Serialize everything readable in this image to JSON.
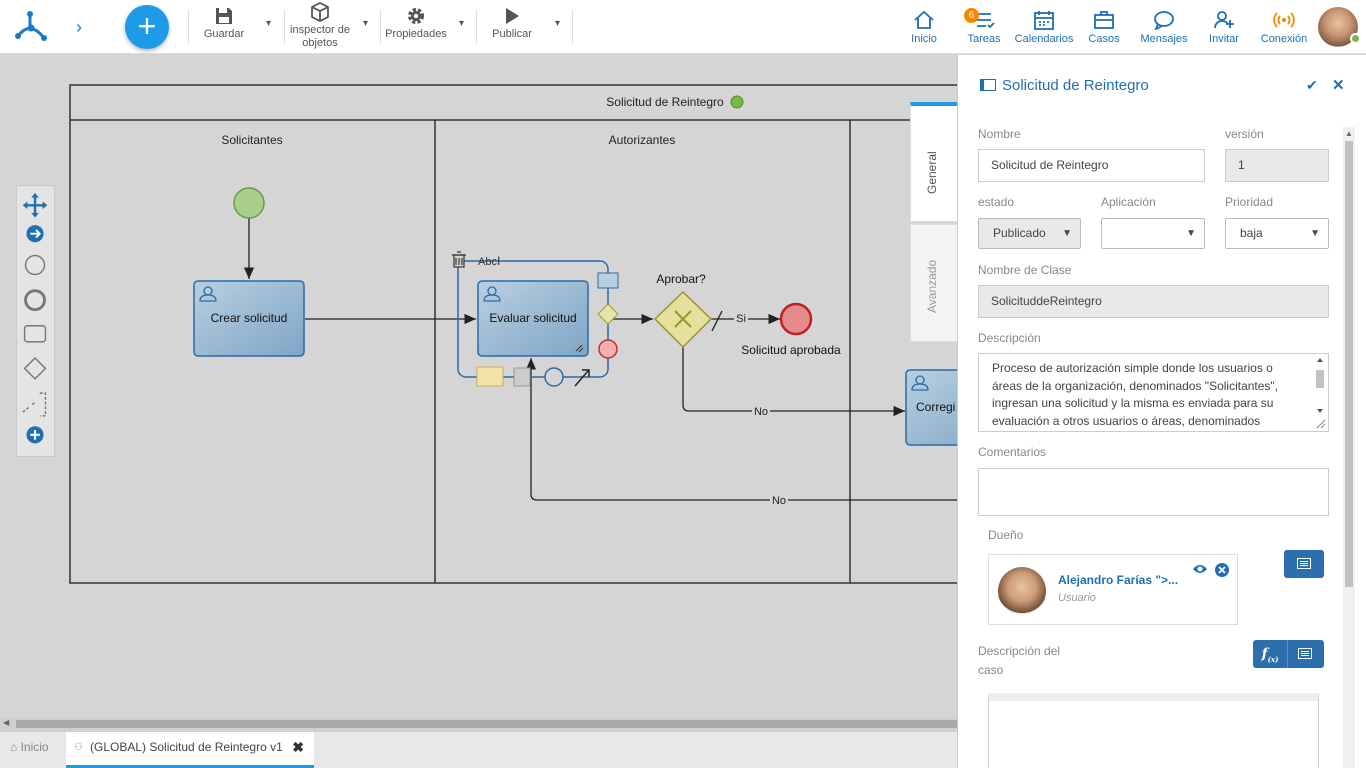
{
  "toolbar": {
    "save_label": "Guardar",
    "inspector_label_1": "inspector de",
    "inspector_label_2": "objetos",
    "properties_label": "Propiedades",
    "publish_label": "Publicar"
  },
  "nav": {
    "home": "Inicio",
    "tasks": "Tareas",
    "tasks_badge": "6",
    "calendars": "Calendarios",
    "cases": "Casos",
    "messages": "Mensajes",
    "invite": "Invitar",
    "connection": "Conexión"
  },
  "diagram": {
    "pool_title": "Solicitud de Reintegro",
    "lanes": [
      "Solicitantes",
      "Autorizantes"
    ],
    "task_create": "Crear solicitud",
    "task_evaluate": "Evaluar solicitud",
    "task_correct": "Corregi",
    "gateway_label": "Aprobar?",
    "end_label": "Solicitud aprobada",
    "flow_yes": "Si",
    "flow_no_1": "No",
    "flow_no_2": "No",
    "text_tool": "Abc"
  },
  "tabs": {
    "home": "Inicio",
    "doc": "(GLOBAL) Solicitud de Reintegro v1"
  },
  "side_tabs": {
    "general": "General",
    "advanced": "Avanzado"
  },
  "panel": {
    "title": "Solicitud de Reintegro",
    "name_label": "Nombre",
    "name_value": "Solicitud de Reintegro",
    "version_label": "versión",
    "version_value": "1",
    "state_label": "estado",
    "state_value": "Publicado",
    "app_label": "Aplicación",
    "app_value": "",
    "priority_label": "Prioridad",
    "priority_value": "baja",
    "class_label": "Nombre de Clase",
    "class_value": "SolicituddeReintegro",
    "desc_label": "Descripción",
    "desc_value": "Proceso de autorización simple donde los usuarios o áreas de la organización, denominados \"Solicitantes\", ingresan una solicitud y la misma es enviada para su evaluación a otros usuarios o áreas, denominados",
    "comments_label": "Comentarios",
    "owner_label": "Dueño",
    "owner_name": "Alejandro Farías \">...",
    "owner_role": "Usuario",
    "case_desc_label_1": "Descripción del",
    "case_desc_label_2": "caso"
  },
  "colors": {
    "accent": "#1e9be6",
    "brand": "#1f6fb2",
    "start": "#a9cf8a",
    "end": "#e06060"
  }
}
